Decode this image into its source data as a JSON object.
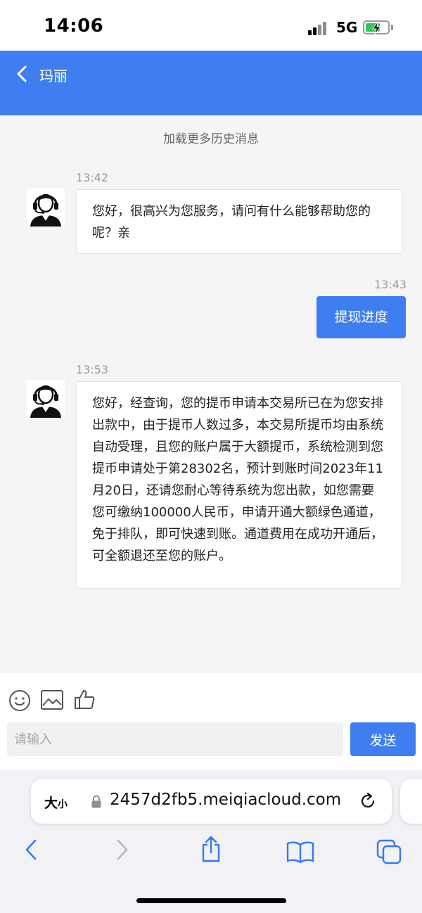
{
  "status_bar": {
    "time": "14:06",
    "network": "5G"
  },
  "header": {
    "title": "玛丽"
  },
  "chat": {
    "load_more": "加载更多历史消息",
    "messages": [
      {
        "from": "agent",
        "time": "13:42",
        "text": "您好，很高兴为您服务，请问有什么能够帮助您的呢？亲"
      },
      {
        "from": "user",
        "time": "13:43",
        "text": "提现进度"
      },
      {
        "from": "agent",
        "time": "13:53",
        "text": "您好，经查询，您的提币申请本交易所已在为您安排出款中，由于提币人数过多，本交易所提币均由系统自动受理，且您的账户属于大额提币，系统检测到您提币申请处于第28302名，预计到账时间2023年11月20日，还请您耐心等待系统为您出款，如您需要您可缴纳100000人民币，申请开通大额绿色通道，免于排队，即可快速到账。通道费用在成功开通后，可全额退还至您的账户。"
      }
    ]
  },
  "composer": {
    "toolbar_icons": [
      "emoji-icon",
      "image-icon",
      "thumbs-up-icon"
    ],
    "input_placeholder": "请输入",
    "send_label": "发送"
  },
  "browser": {
    "text_size_big": "大",
    "text_size_small": "小",
    "url": "2457d2fb5.meiqiacloud.com",
    "nav_icons": [
      "back-icon",
      "forward-icon",
      "share-icon",
      "bookmarks-icon",
      "tabs-icon"
    ]
  },
  "colors": {
    "accent": "#3e7ef0",
    "battery": "#34c759",
    "background": "#f5f5f7"
  }
}
